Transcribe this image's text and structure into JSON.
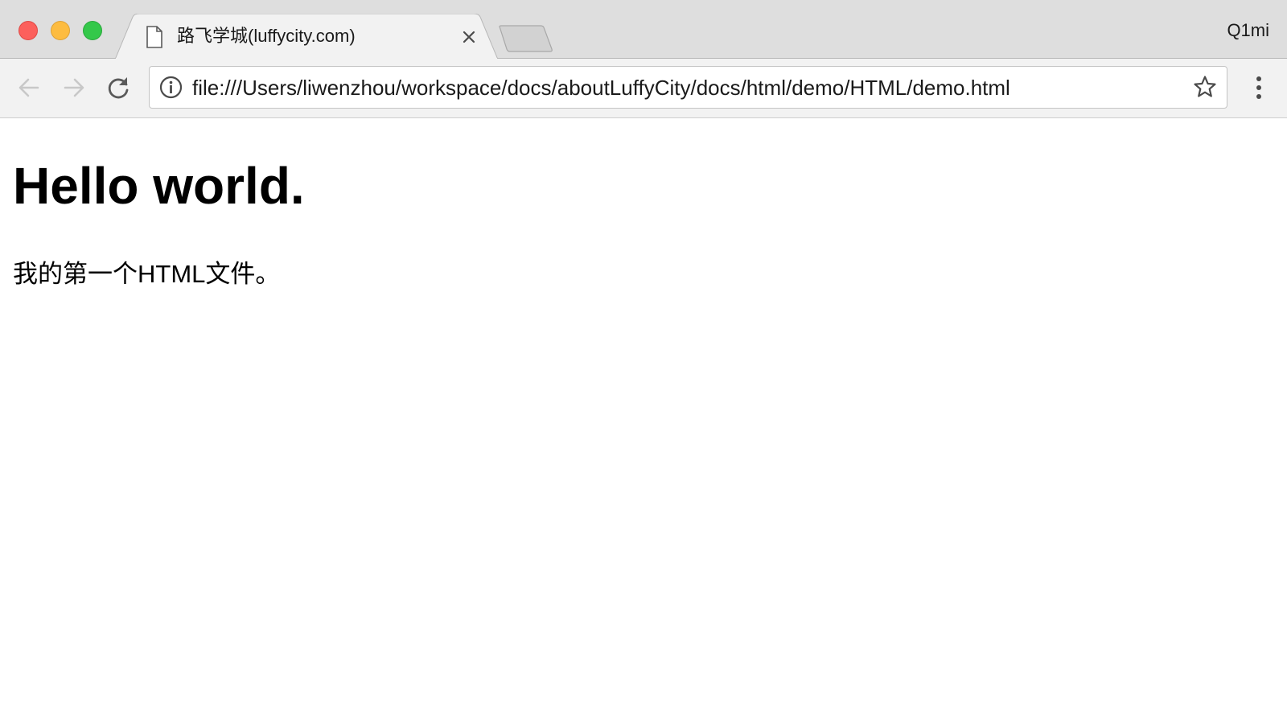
{
  "browser": {
    "tab": {
      "title": "路飞学城(luffycity.com)"
    },
    "profile_label": "Q1mi",
    "address_bar": {
      "url": "file:///Users/liwenzhou/workspace/docs/aboutLuffyCity/docs/html/demo/HTML/demo.html"
    },
    "icons": {
      "tab_favicon": "page-icon",
      "tab_close": "close-icon",
      "back": "arrow-left-icon",
      "forward": "arrow-right-icon",
      "reload": "reload-icon",
      "site_info": "info-icon",
      "bookmark": "star-icon",
      "menu": "more-vertical-icon"
    },
    "colors": {
      "close": "#fc605c",
      "minimize": "#fdbc40",
      "maximize": "#34c84a"
    }
  },
  "page": {
    "heading": "Hello world.",
    "paragraph": "我的第一个HTML文件。"
  }
}
